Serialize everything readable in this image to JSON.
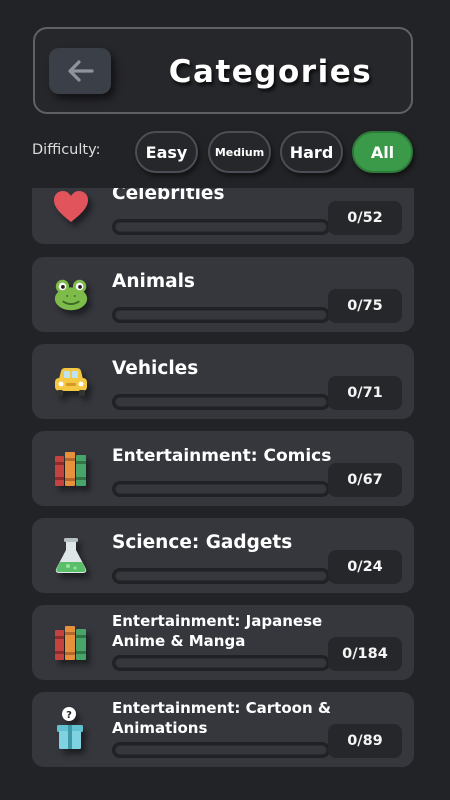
{
  "header": {
    "back_icon": "arrow-left-icon",
    "title": "Categories"
  },
  "difficulty": {
    "label": "Difficulty:",
    "options": [
      "Easy",
      "Medium",
      "Hard",
      "All"
    ],
    "selected": "All"
  },
  "colors": {
    "background": "#222326",
    "card": "#35373d",
    "selected_pill": "#3a9a4a"
  },
  "categories": [
    {
      "name": "Celebrities",
      "count": "0/52",
      "progress": 0,
      "icon": "heart-icon"
    },
    {
      "name": "Animals",
      "count": "0/75",
      "progress": 0,
      "icon": "frog-icon"
    },
    {
      "name": "Vehicles",
      "count": "0/71",
      "progress": 0,
      "icon": "car-icon"
    },
    {
      "name": "Entertainment: Comics",
      "count": "0/67",
      "progress": 0,
      "icon": "books-icon"
    },
    {
      "name": "Science: Gadgets",
      "count": "0/24",
      "progress": 0,
      "icon": "flask-icon"
    },
    {
      "name": "Entertainment: Japanese Anime & Manga",
      "count": "0/184",
      "progress": 0,
      "icon": "books-icon"
    },
    {
      "name": "Entertainment: Cartoon & Animations",
      "count": "0/89",
      "progress": 0,
      "icon": "mystery-box-icon"
    }
  ]
}
